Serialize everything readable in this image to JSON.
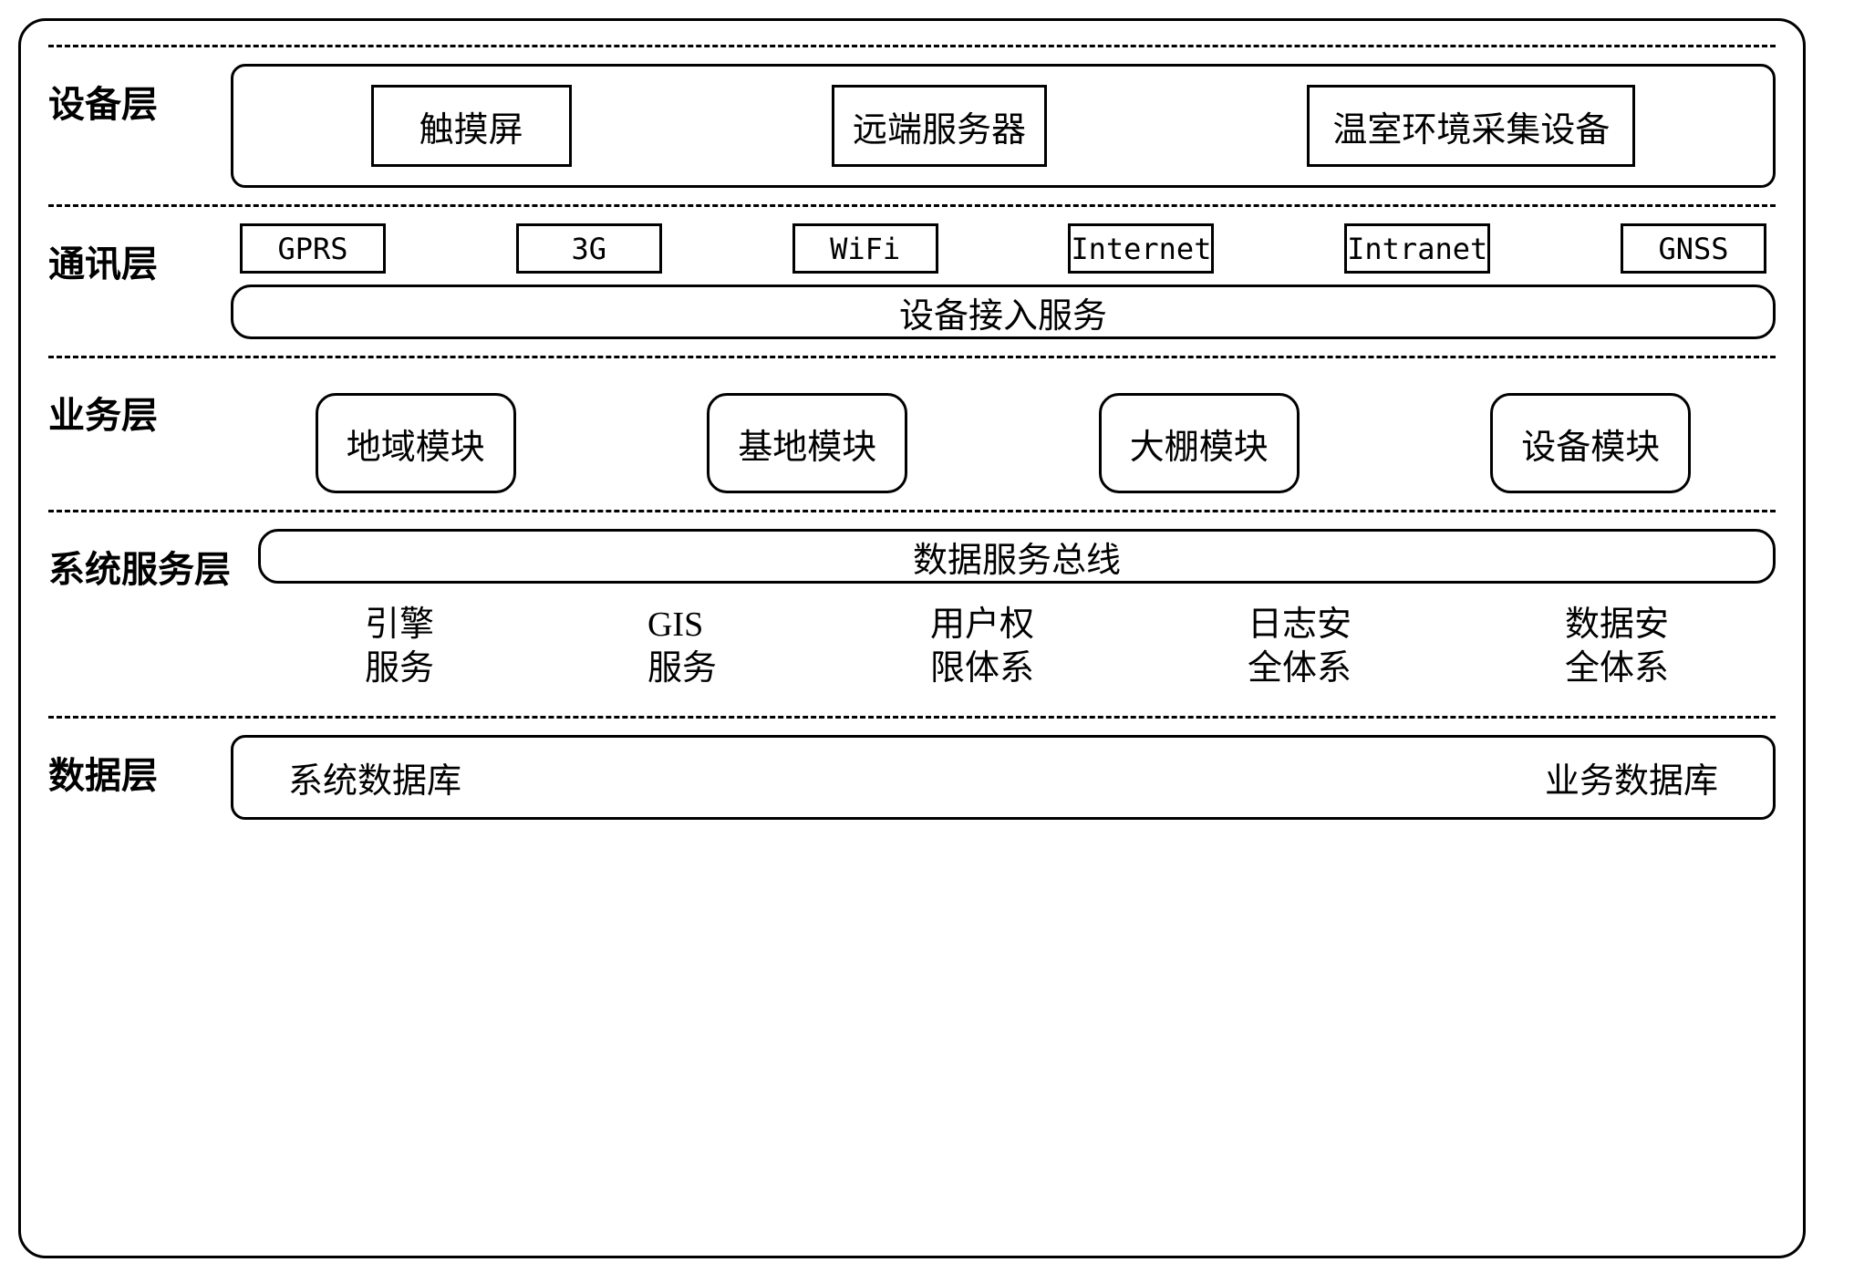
{
  "layers": {
    "device": {
      "label": "设备层",
      "items": [
        "触摸屏",
        "远端服务器",
        "温室环境采集设备"
      ]
    },
    "comm": {
      "label": "通讯层",
      "protocols": [
        "GPRS",
        "3G",
        "WiFi",
        "Internet",
        "Intranet",
        "GNSS"
      ],
      "access": "设备接入服务"
    },
    "business": {
      "label": "业务层",
      "modules": [
        "地域模块",
        "基地模块",
        "大棚模块",
        "设备模块"
      ]
    },
    "system_service": {
      "label": "系统服务层",
      "bus": "数据服务总线",
      "services": [
        {
          "l1": "引擎",
          "l2": "服务"
        },
        {
          "l1": "GIS",
          "l2": "服务"
        },
        {
          "l1": "用户权",
          "l2": "限体系"
        },
        {
          "l1": "日志安",
          "l2": "全体系"
        },
        {
          "l1": "数据安",
          "l2": "全体系"
        }
      ]
    },
    "data": {
      "label": "数据层",
      "dbs": [
        "系统数据库",
        "业务数据库"
      ]
    }
  }
}
